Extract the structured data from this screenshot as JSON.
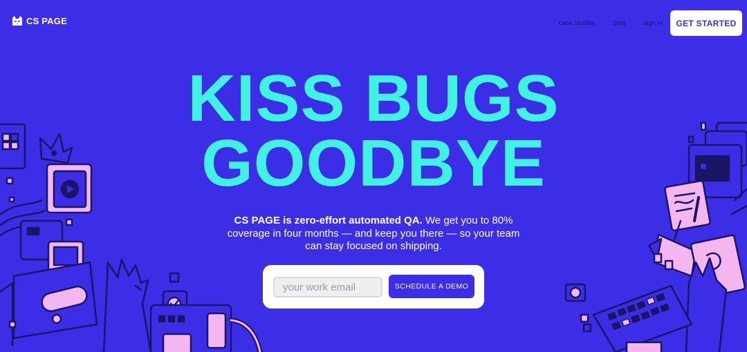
{
  "brand": {
    "name": "CS PAGE",
    "logo_icon": "cat-face-icon"
  },
  "nav": {
    "links": [
      "case studies",
      "blog",
      "sign in"
    ],
    "cta_label": "GET STARTED"
  },
  "hero": {
    "title_line1": "KISS BUGS",
    "title_line2": "GOODBYE",
    "subtitle_bold": "CS PAGE is zero-effort automated QA.",
    "subtitle_rest": " We get you to 80% coverage in four months — and keep you there — so your team can stay focused on shipping."
  },
  "signup": {
    "email_placeholder": "your work email",
    "email_value": "",
    "button_label": "SCHEDULE A DEMO"
  },
  "colors": {
    "background": "#3b2ee6",
    "title": "#3ff2e4",
    "accent_pink": "#f3b6ee",
    "ink": "#1b1566"
  }
}
